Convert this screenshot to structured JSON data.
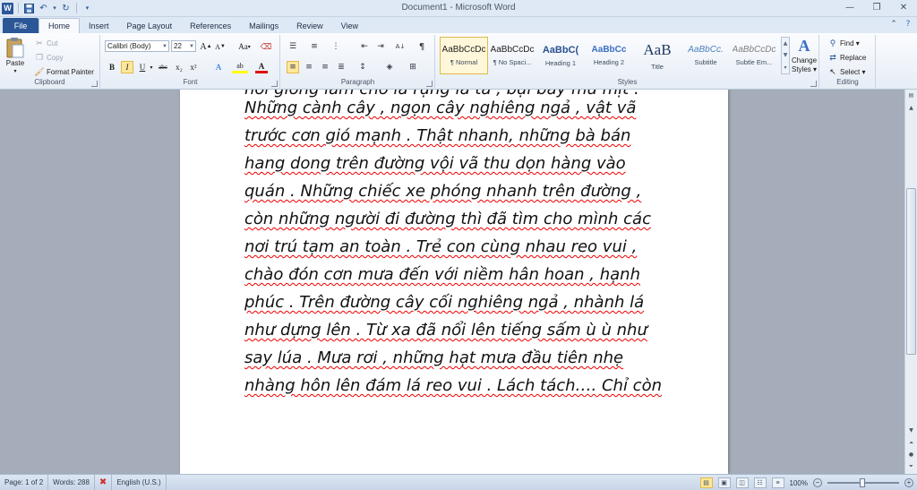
{
  "window": {
    "title": "Document1 - Microsoft Word",
    "logo_letter": "W",
    "controls": [
      "—",
      "❐",
      "✕"
    ]
  },
  "qat": {
    "save": "💾",
    "undo": "↶",
    "redo": "↻",
    "more": "▾"
  },
  "tabs": {
    "file": "File",
    "items": [
      "Home",
      "Insert",
      "Page Layout",
      "References",
      "Mailings",
      "Review",
      "View"
    ],
    "active": "Home"
  },
  "clipboard": {
    "label": "Clipboard",
    "paste": "Paste",
    "cut": "Cut",
    "copy": "Copy",
    "format_painter": "Format Painter"
  },
  "font": {
    "label": "Font",
    "family": "Calibri (Body)",
    "size": "22",
    "grow": "A",
    "shrink": "A",
    "case": "Aa",
    "bold": "B",
    "italic": "I",
    "underline": "U",
    "strike": "abc",
    "sub": "x₂",
    "sup": "x²",
    "text_effects": "A",
    "highlight": "ab",
    "color": "A"
  },
  "paragraph": {
    "label": "Paragraph",
    "sort": "A↓",
    "pilcrow": "¶"
  },
  "styles": {
    "label": "Styles",
    "items": [
      {
        "sample": "AaBbCcDc",
        "name": "¶ Normal"
      },
      {
        "sample": "AaBbCcDc",
        "name": "¶ No Spaci..."
      },
      {
        "sample": "AaBbC(",
        "name": "Heading 1"
      },
      {
        "sample": "AaBbCc",
        "name": "Heading 2"
      },
      {
        "sample": "AaB",
        "name": "Title"
      },
      {
        "sample": "AaBbCc.",
        "name": "Subtitle"
      },
      {
        "sample": "AaBbCcDc",
        "name": "Subtle Em..."
      }
    ],
    "change_styles_line1": "Change",
    "change_styles_line2": "Styles ▾"
  },
  "editing": {
    "label": "Editing",
    "find": "Find ▾",
    "replace": "Replace",
    "select": "Select ▾"
  },
  "document": {
    "lines": [
      "nơi giống làm cho lá rụng lả tả , bụi bay mù mịt .",
      "Những cành cây , ngọn cây nghiêng ngả , vật vã",
      "trước cơn gió mạnh .  Thật nhanh, những bà bán",
      "hang dong trên đường vội vã thu dọn hàng vào",
      "quán . Những chiếc xe phóng nhanh trên đường ,",
      "còn những người đi đường thì đã tìm cho mình các",
      "nơi trú tạm an toàn . Trẻ con cùng nhau reo vui ,",
      "chào đón cơn mưa đến với niềm hân hoan , hạnh",
      "phúc . Trên đường cây cối nghiêng ngả , nhành lá",
      "như dựng lên . Từ xa đã nổi lên tiếng sấm ù ù như",
      "say lúa . Mưa rơi , những hạt mưa đầu tiên nhẹ",
      "nhàng hôn lên đám lá reo vui . Lách tách…. Chỉ còn"
    ]
  },
  "status": {
    "page": "Page: 1 of 2",
    "words": "Words: 288",
    "language": "English (U.S.)",
    "zoom": "100%"
  }
}
